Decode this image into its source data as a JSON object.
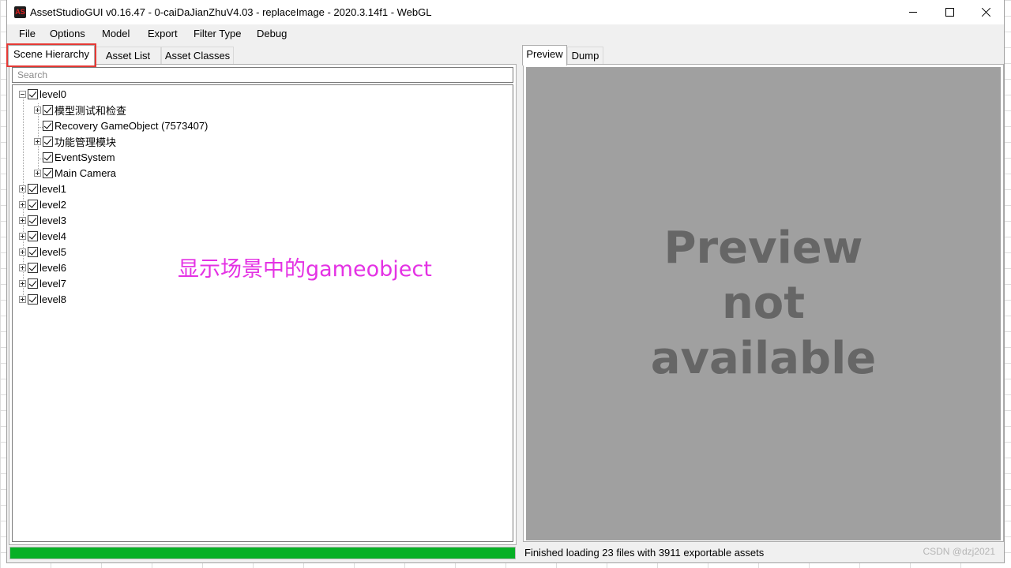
{
  "window": {
    "title": "AssetStudioGUI v0.16.47 - 0-caiDaJianZhuV4.03 - replaceImage - 2020.3.14f1 - WebGL",
    "icon_text": "AS"
  },
  "menubar": {
    "items": [
      "File",
      "Options",
      "Model",
      "Export",
      "Filter Type",
      "Debug"
    ]
  },
  "left_tabs": [
    {
      "label": "Scene Hierarchy",
      "active": true
    },
    {
      "label": "Asset List",
      "active": false
    },
    {
      "label": "Asset Classes",
      "active": false
    }
  ],
  "search": {
    "placeholder": "Search",
    "value": ""
  },
  "tree": {
    "level0": {
      "label": "level0",
      "children": [
        "模型测试和检查",
        "Recovery GameObject (7573407)",
        "功能管理模块",
        "EventSystem",
        "Main Camera"
      ]
    },
    "levels": [
      "level1",
      "level2",
      "level3",
      "level4",
      "level5",
      "level6",
      "level7",
      "level8"
    ]
  },
  "annotation": "显示场景中的gameobject",
  "progress": {
    "percent": 100,
    "color": "#06b025"
  },
  "right_tabs": [
    {
      "label": "Preview",
      "active": true
    },
    {
      "label": "Dump",
      "active": false
    }
  ],
  "preview": {
    "line1": "Preview",
    "line2": "not",
    "line3": "available"
  },
  "status_text": "Finished loading 23 files with 3911 exportable assets",
  "watermark": "CSDN @dzj2021"
}
